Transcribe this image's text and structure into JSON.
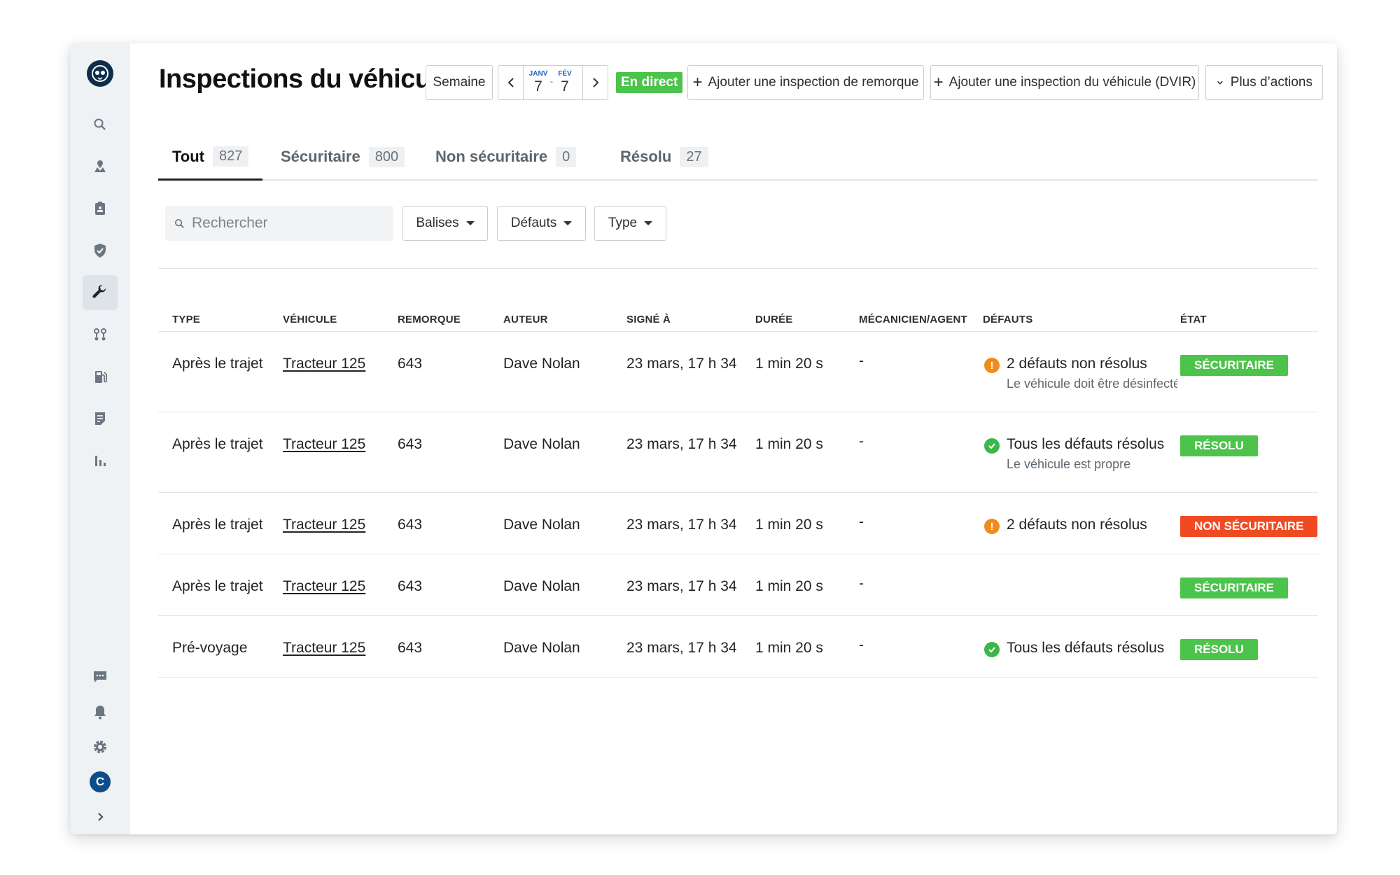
{
  "page": {
    "title": "Inspections du véhicule"
  },
  "toolbar": {
    "range_label": "Semaine",
    "date_start_month": "JANV",
    "date_start_day": "7",
    "date_separator": "-",
    "date_end_month": "FÉV",
    "date_end_day": "7",
    "live_label": "En direct",
    "add_trailer_label": "Ajouter une inspection de remorque",
    "add_vehicle_label": "Ajouter une inspection du véhicule (DVIR)",
    "more_actions_label": "Plus d’actions"
  },
  "tabs": [
    {
      "label": "Tout",
      "count": "827"
    },
    {
      "label": "Sécuritaire",
      "count": "800"
    },
    {
      "label": "Non sécuritaire",
      "count": "0"
    },
    {
      "label": "Résolu",
      "count": "27"
    }
  ],
  "filters": {
    "search_placeholder": "Rechercher",
    "tags_label": "Balises",
    "defects_label": "Défauts",
    "type_label": "Type"
  },
  "table": {
    "columns": [
      "TYPE",
      "VÉHICULE",
      "REMORQUE",
      "AUTEUR",
      "SIGNÉ À",
      "DURÉE",
      "MÉCANICIEN/AGENT",
      "DÉFAUTS",
      "ÉTAT"
    ],
    "rows": [
      {
        "type": "Après le trajet",
        "vehicle": "Tracteur 125",
        "trailer": "643",
        "author": "Dave Nolan",
        "signed": "23 mars, 17 h 34",
        "duration": "1 min 20 s",
        "mechanic": "-",
        "defect_icon": "warning-icon",
        "defects": "2 défauts non résolus",
        "defect_note": "Le véhicule doit être désinfecté",
        "status": "SÉCURITAIRE",
        "status_color": "#4cc34a"
      },
      {
        "type": "Après le trajet",
        "vehicle": "Tracteur 125",
        "trailer": "643",
        "author": "Dave Nolan",
        "signed": "23 mars, 17 h 34",
        "duration": "1 min 20 s",
        "mechanic": "-",
        "defect_icon": "check-circle-icon",
        "defects": "Tous les défauts résolus",
        "defect_note": "Le véhicule est propre",
        "status": "RÉSOLU",
        "status_color": "#4cc34a"
      },
      {
        "type": "Après le trajet",
        "vehicle": "Tracteur 125",
        "trailer": "643",
        "author": "Dave Nolan",
        "signed": "23 mars, 17 h 34",
        "duration": "1 min 20 s",
        "mechanic": "-",
        "defect_icon": "warning-icon",
        "defects": "2 défauts non résolus",
        "defect_note": "",
        "status": "NON SÉCURITAIRE",
        "status_color": "#f04a23"
      },
      {
        "type": "Après le trajet",
        "vehicle": "Tracteur 125",
        "trailer": "643",
        "author": "Dave Nolan",
        "signed": "23 mars, 17 h 34",
        "duration": "1 min 20 s",
        "mechanic": "-",
        "defect_icon": "",
        "defects": "",
        "defect_note": "",
        "status": "SÉCURITAIRE",
        "status_color": "#4cc34a"
      },
      {
        "type": "Pré-voyage",
        "vehicle": "Tracteur 125",
        "trailer": "643",
        "author": "Dave Nolan",
        "signed": "23 mars, 17 h 34",
        "duration": "1 min 20 s",
        "mechanic": "-",
        "defect_icon": "check-circle-icon",
        "defects": "Tous les défauts résolus",
        "defect_note": "",
        "status": "RÉSOLU",
        "status_color": "#4cc34a"
      }
    ]
  },
  "sidebar": {
    "avatar_initial": "C",
    "icons": [
      "search-icon",
      "map-pin-icon",
      "clipboard-icon",
      "shield-check-icon",
      "wrench-icon",
      "route-icon",
      "fuel-icon",
      "document-icon",
      "bar-chart-icon",
      "chat-icon",
      "bell-icon",
      "gear-icon",
      "chevron-right-icon"
    ]
  },
  "colors": {
    "safe": "#4cc34a",
    "unsafe": "#f04a23",
    "warning": "#f08c1e",
    "sidebar_bg": "#eef2f5"
  }
}
